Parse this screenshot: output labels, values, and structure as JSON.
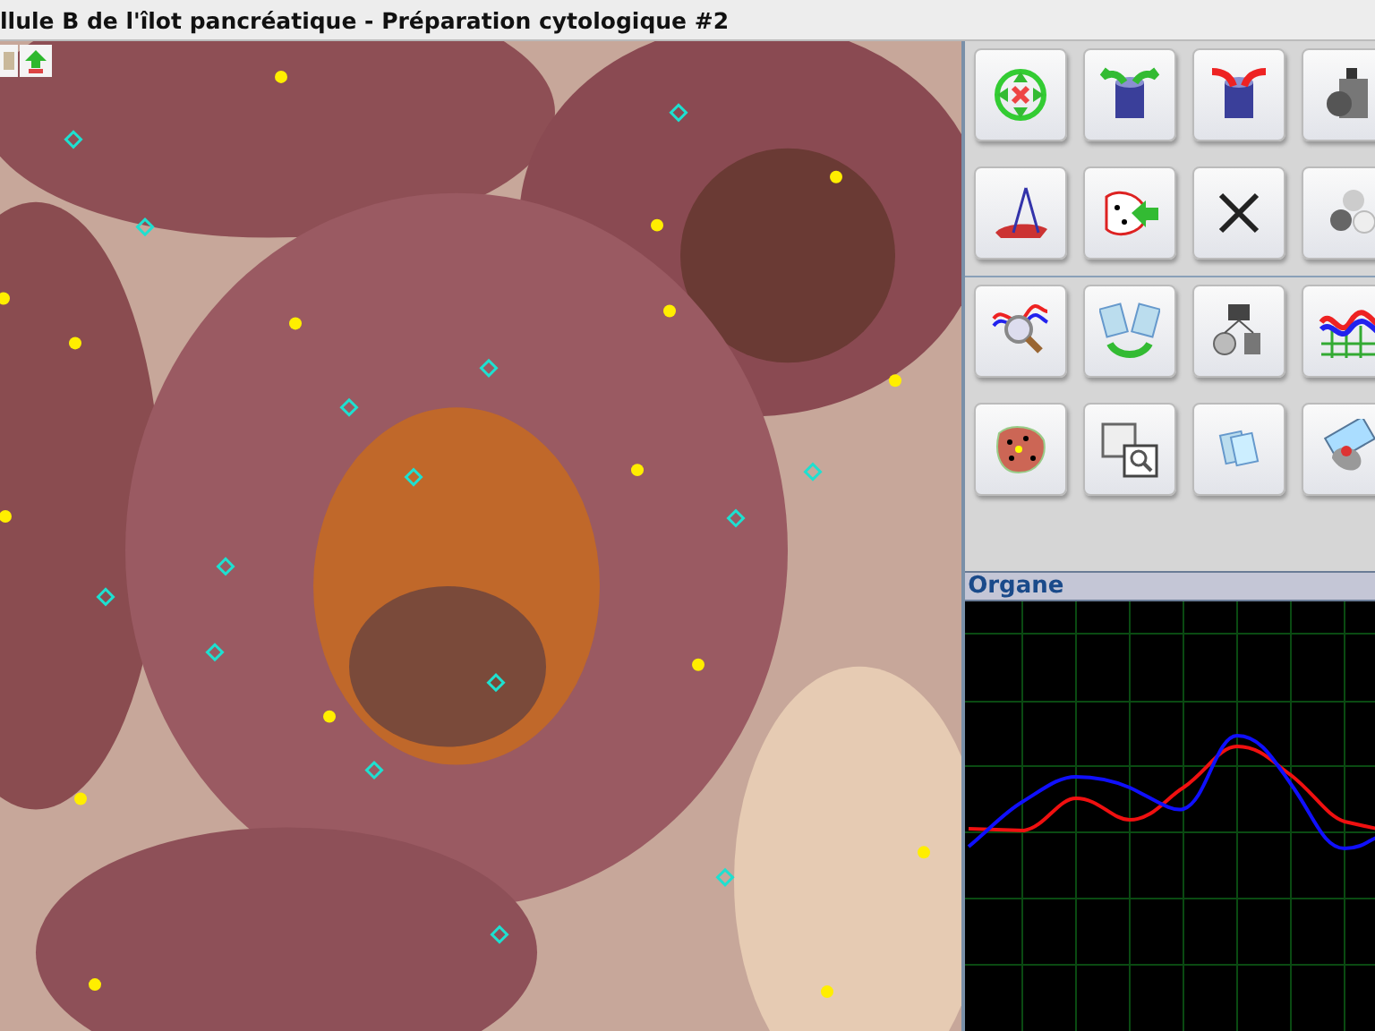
{
  "window": {
    "title": "llule B de l'îlot pancréatique - Préparation cytologique #2"
  },
  "graph_panel": {
    "title": "Organe"
  }
}
